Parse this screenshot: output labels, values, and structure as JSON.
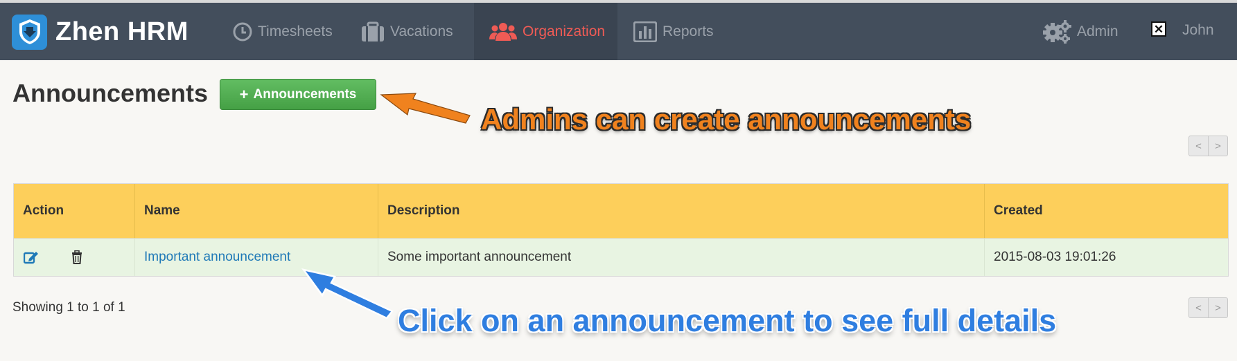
{
  "app": {
    "brand": "Zhen HRM"
  },
  "nav": {
    "items": [
      {
        "label": "Timesheets",
        "icon": "clock-icon"
      },
      {
        "label": "Vacations",
        "icon": "briefcase-icon"
      },
      {
        "label": "Organization",
        "icon": "users-icon",
        "active": true
      },
      {
        "label": "Reports",
        "icon": "bar-chart-icon"
      }
    ],
    "admin_label": "Admin",
    "close_glyph": "✕",
    "user_name": "John"
  },
  "page": {
    "title": "Announcements",
    "add_button_label": "Announcements",
    "add_button_glyph": "+"
  },
  "pager": {
    "prev": "<",
    "next": ">"
  },
  "table": {
    "headers": {
      "action": "Action",
      "name": "Name",
      "description": "Description",
      "created": "Created"
    },
    "rows": [
      {
        "name": "Important announcement",
        "description": "Some important announcement",
        "created": "2015-08-03 19:01:26"
      }
    ]
  },
  "footer": {
    "showing": "Showing 1 to 1 of 1"
  },
  "annotations": {
    "top": "Admins can create announcements",
    "bottom": "Click on an announcement to see full details"
  },
  "colors": {
    "navbar": "#434e5c",
    "active_nav": "#ef5b55",
    "header_row": "#fdcf5b",
    "add_button": "#4cae4c",
    "callout_orange": "#f0821e",
    "callout_blue": "#2f7ee0",
    "link": "#1f79b7"
  }
}
